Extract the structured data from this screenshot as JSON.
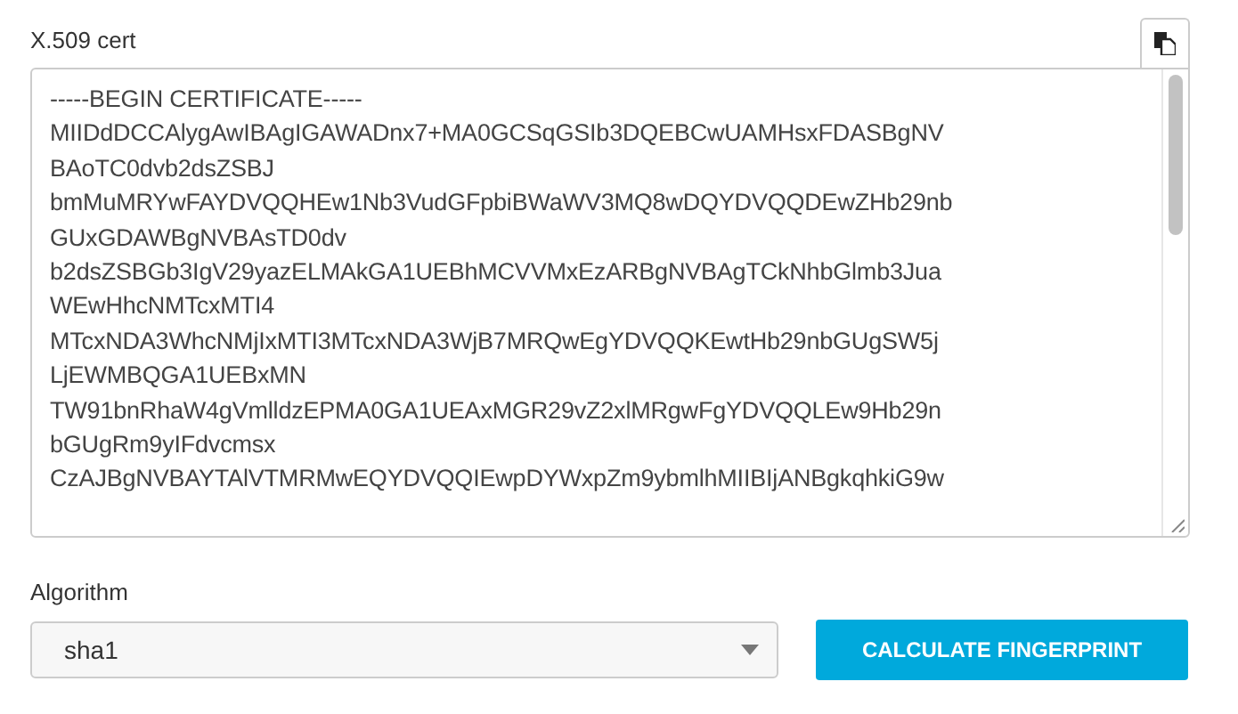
{
  "cert": {
    "label": "X.509 cert",
    "lines": [
      "-----BEGIN CERTIFICATE-----",
      "MIIDdDCCAlygAwIBAgIGAWADnx7+MA0GCSqGSIb3DQEBCwUAMHsxFDASBgNV",
      "BAoTC0dvb2dsZSBJ",
      "bmMuMRYwFAYDVQQHEw1Nb3VudGFpbiBWaWV3MQ8wDQYDVQQDEwZHb29nb",
      "GUxGDAWBgNVBAsTD0dv",
      "b2dsZSBGb3IgV29yazELMAkGA1UEBhMCVVMxEzARBgNVBAgTCkNhbGlmb3Jua",
      "WEwHhcNMTcxMTI4",
      "MTcxNDA3WhcNMjIxMTI3MTcxNDA3WjB7MRQwEgYDVQQKEwtHb29nbGUgSW5j",
      "LjEWMBQGA1UEBxMN",
      "TW91bnRhaW4gVmlldzEPMA0GA1UEAxMGR29vZ2xlMRgwFgYDVQQLEw9Hb29n",
      "bGUgRm9yIFdvcmsx",
      "CzAJBgNVBAYTAlVTMRMwEQYDVQQIEwpDYWxpZm9ybmlhMIIBIjANBgkqhkiG9w"
    ]
  },
  "algorithm": {
    "label": "Algorithm",
    "value": "sha1"
  },
  "button": {
    "label": "CALCULATE FINGERPRINT"
  }
}
